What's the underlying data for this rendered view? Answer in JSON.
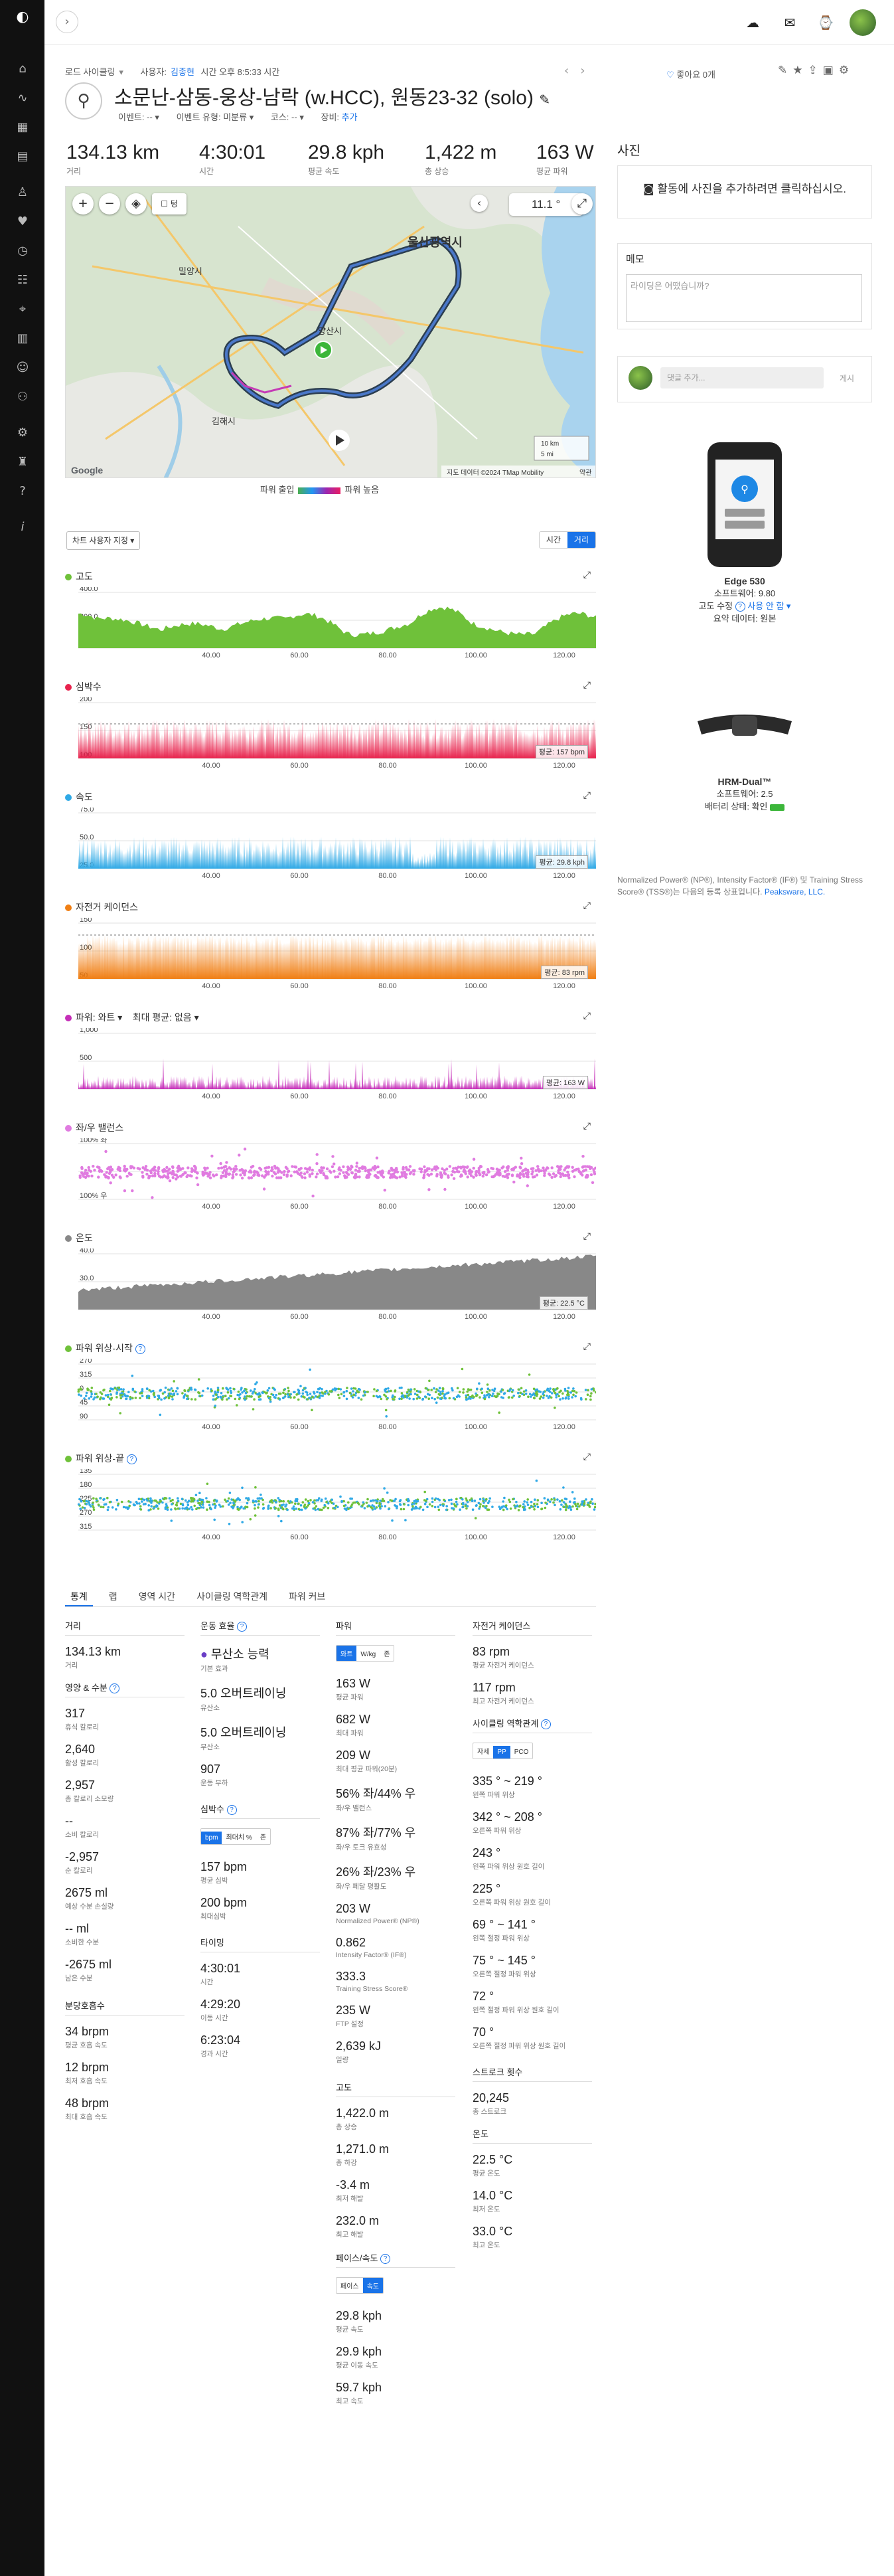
{
  "activity": {
    "breadcrumb": "로드 사이클링",
    "user_label": "사용자:",
    "user_name": "김종현",
    "time_text": "시간 오후 8:5:33 시간",
    "title": "소문난-삼동-웅상-남락 (w.HCC), 원동23-32 (solo)",
    "event_label": "이벤트:",
    "event_value": "--",
    "event_type_label": "이벤트 유형:",
    "event_type_value": "미분류",
    "course_label": "코스:",
    "course_value": "--",
    "gear_label": "장비:",
    "gear_value": "추가",
    "likes": "좋아요 0개"
  },
  "stats": [
    {
      "value": "134.13 km",
      "label": "거리"
    },
    {
      "value": "4:30:01",
      "label": "시간"
    },
    {
      "value": "29.8 kph",
      "label": "평균 속도"
    },
    {
      "value": "1,422 m",
      "label": "총 상승"
    },
    {
      "value": "163 W",
      "label": "평균 파워"
    }
  ],
  "map": {
    "city_ulsan": "울산광역시",
    "city_yangsan": "양산시",
    "city_gimhae": "김해시",
    "city_miryang": "밀양시",
    "temp": "11.1 °",
    "scale_km": "10 km",
    "scale_mi": "5 mi",
    "attribution": "지도 데이터 ©2024 TMap Mobility",
    "report": "약관",
    "google": "Google",
    "legend_low": "파워 출입",
    "legend_high": "파워 높음",
    "layers_label": "텅"
  },
  "chart_controls": {
    "settings": "차트 사용자 지정",
    "time": "시간",
    "distance": "거리"
  },
  "charts": [
    {
      "key": "elev",
      "title": "고도",
      "color": "#6fc13a",
      "avg": "",
      "ylabels": [
        "400.0",
        "200.0",
        "0.0"
      ]
    },
    {
      "key": "hr",
      "title": "심박수",
      "color": "#e8234d",
      "avg": "평균: 157 bpm",
      "ylabels": [
        "200",
        "150",
        "100"
      ]
    },
    {
      "key": "speed",
      "title": "속도",
      "color": "#2fa9e6",
      "avg": "평균: 29.8 kph",
      "ylabels": [
        "75.0",
        "50.0",
        "25.0"
      ]
    },
    {
      "key": "cad",
      "title": "자전거 케이던스",
      "color": "#f07f14",
      "avg": "평균: 83 rpm",
      "ylabels": [
        "150",
        "100",
        "50"
      ]
    },
    {
      "key": "power",
      "title": "파워: 와트",
      "color": "#c52eb8",
      "avg": "평균: 163 W",
      "ylabels": [
        "1,000",
        "500",
        ""
      ],
      "extra1": "파워: 와트 ▾",
      "extra2": "최대 평균: 없음 ▾"
    },
    {
      "key": "bal",
      "title": "좌/우 밸런스",
      "color": "#e07be0",
      "avg": "",
      "ylabels": [
        "100% 좌",
        "",
        "100% 우"
      ]
    },
    {
      "key": "temp",
      "title": "온도",
      "color": "#888888",
      "avg": "평균: 22.5 °C",
      "ylabels": [
        "40.0",
        "30.0",
        "20.0"
      ]
    },
    {
      "key": "pps",
      "title": "파워 위상-시작",
      "color": "#6fc13a",
      "avg": "",
      "ylabels": [
        "270",
        "315",
        "0",
        "45",
        "90"
      ]
    },
    {
      "key": "ppe",
      "title": "파워 위상-끝",
      "color": "#6fc13a",
      "avg": "",
      "ylabels": [
        "135",
        "180",
        "225",
        "270",
        "315"
      ]
    }
  ],
  "xticks": [
    "40.00",
    "60.00",
    "80.00",
    "100.00",
    "120.00"
  ],
  "right": {
    "photos_title": "사진",
    "photos_cta": "활동에 사진을 추가하려면 클릭하십시오.",
    "memo_title": "메모",
    "memo_placeholder": "라이딩은 어땠습니까?",
    "comment_placeholder": "댓글 추가...",
    "comment_post": "게시",
    "device1_name": "Edge 530",
    "device1_sw": "소프트웨어: 9.80",
    "device1_alt": "고도 수정",
    "device1_alt_val": "사용 안 함 ▾",
    "device1_summary": "요약 데이터: 원본",
    "device2_name": "HRM-Dual™",
    "device2_sw": "소프트웨어: 2.5",
    "device2_battery": "배터리 상태: 확인",
    "note": "Normalized Power® (NP®), Intensity Factor® (IF®) 및 Training Stress Score® (TSS®)는 다음의 등록 상표입니다.",
    "note_link": "Peaksware, LLC."
  },
  "tabs": [
    "통계",
    "랩",
    "영역 시간",
    "사이클링 역학관계",
    "파워 커브"
  ],
  "summary": {
    "col1": {
      "dist_h": "거리",
      "dist_v": "134.13 km",
      "dist_l": "거리",
      "nut_h": "영양 & 수분",
      "items": [
        {
          "v": "317",
          "l": "휴식 칼로리"
        },
        {
          "v": "2,640",
          "l": "활성 칼로리"
        },
        {
          "v": "2,957",
          "l": "총 칼로리 소모량"
        },
        {
          "v": "--",
          "l": "소비 칼로리"
        },
        {
          "v": "-2,957",
          "l": "순 칼로리"
        },
        {
          "v": "2675 ml",
          "l": "예상 수분 손실량"
        },
        {
          "v": "-- ml",
          "l": "소비한 수분"
        },
        {
          "v": "-2675 ml",
          "l": "남은 수분"
        }
      ],
      "resp_h": "분당호흡수",
      "resp": [
        {
          "v": "34 brpm",
          "l": "평균 호흡 속도"
        },
        {
          "v": "12 brpm",
          "l": "최저 호흡 속도"
        },
        {
          "v": "48 brpm",
          "l": "최대 호흡 속도"
        }
      ]
    },
    "col2": {
      "te_h": "운동 효율",
      "te_primary": "무산소 능력",
      "te_primary_l": "기본 효과",
      "items": [
        {
          "v": "5.0 오버트레이닝",
          "l": "유산소"
        },
        {
          "v": "5.0 오버트레이닝",
          "l": "무산소"
        },
        {
          "v": "907",
          "l": "운동 부하"
        }
      ],
      "hr_h": "심박수",
      "hr_seg": [
        "bpm",
        "최대치 %",
        "존"
      ],
      "hr_items": [
        {
          "v": "157 bpm",
          "l": "평균 심박"
        },
        {
          "v": "200 bpm",
          "l": "최대심박"
        }
      ],
      "timing_h": "타이밍",
      "timing": [
        {
          "v": "4:30:01",
          "l": "시간"
        },
        {
          "v": "4:29:20",
          "l": "이동 시간"
        },
        {
          "v": "6:23:04",
          "l": "경과 시간"
        }
      ]
    },
    "col3": {
      "pw_h": "파워",
      "pw_seg": [
        "와트",
        "W/kg",
        "존"
      ],
      "items": [
        {
          "v": "163 W",
          "l": "평균 파워"
        },
        {
          "v": "682 W",
          "l": "최대 파워"
        },
        {
          "v": "209 W",
          "l": "최대 평균 파워(20분)"
        },
        {
          "v": "56% 좌/44% 우",
          "l": "좌/우 밸런스"
        },
        {
          "v": "87% 좌/77% 우",
          "l": "좌/우 토크 유효성"
        },
        {
          "v": "26% 좌/23% 우",
          "l": "좌/우 페달 평활도"
        },
        {
          "v": "203 W",
          "l": "Normalized Power® (NP®)"
        },
        {
          "v": "0.862",
          "l": "Intensity Factor® (IF®)"
        },
        {
          "v": "333.3",
          "l": "Training Stress Score®"
        },
        {
          "v": "235 W",
          "l": "FTP 설정"
        },
        {
          "v": "2,639 kJ",
          "l": "일량"
        }
      ],
      "el_h": "고도",
      "el": [
        {
          "v": "1,422.0 m",
          "l": "총 상승"
        },
        {
          "v": "1,271.0 m",
          "l": "총 하강"
        },
        {
          "v": "-3.4 m",
          "l": "최저 해발"
        },
        {
          "v": "232.0 m",
          "l": "최고 해발"
        }
      ],
      "pace_h": "페이스/속도",
      "pace_seg": [
        "페이스",
        "속도"
      ],
      "pace": [
        {
          "v": "29.8 kph",
          "l": "평균 속도"
        },
        {
          "v": "29.9 kph",
          "l": "평균 이동 속도"
        },
        {
          "v": "59.7 kph",
          "l": "최고 속도"
        }
      ]
    },
    "col4": {
      "cad_h": "자전거 케이던스",
      "cad": [
        {
          "v": "83 rpm",
          "l": "평균 자전거 케이던스"
        },
        {
          "v": "117 rpm",
          "l": "최고 자전거 케이던스"
        }
      ],
      "dyn_h": "사이클링 역학관계",
      "dyn_seg": [
        "자세",
        "PP",
        "PCO"
      ],
      "dyn": [
        {
          "v": "335 ° ~ 219 °",
          "l": "왼쪽 파워 위상"
        },
        {
          "v": "342 ° ~ 208 °",
          "l": "오른쪽 파워 위상"
        },
        {
          "v": "243 °",
          "l": "왼쪽 파워 위상 원호 길이"
        },
        {
          "v": "225 °",
          "l": "오른쪽 파워 위상 원호 길이"
        },
        {
          "v": "69 ° ~ 141 °",
          "l": "왼쪽 절정 파워 위상"
        },
        {
          "v": "75 ° ~ 145 °",
          "l": "오른쪽 절정 파워 위상"
        },
        {
          "v": "72 °",
          "l": "왼쪽 절정 파워 위상 원호 길이"
        },
        {
          "v": "70 °",
          "l": "오른쪽 절정 파워 위상 원호 길이"
        }
      ],
      "stroke_h": "스트로크 횟수",
      "stroke": [
        {
          "v": "20,245",
          "l": "총 스트로크"
        }
      ],
      "temp_h": "온도",
      "temp": [
        {
          "v": "22.5 °C",
          "l": "평균 온도"
        },
        {
          "v": "14.0 °C",
          "l": "최저 온도"
        },
        {
          "v": "33.0 °C",
          "l": "최고 온도"
        }
      ]
    }
  }
}
